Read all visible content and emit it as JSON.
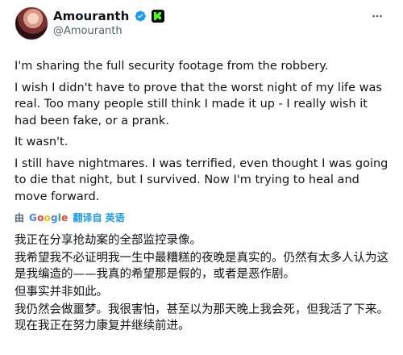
{
  "author": {
    "display_name": "Amouranth",
    "handle": "@Amouranth",
    "verified_color": "#1d9bf0",
    "badge_color": "#53fc18"
  },
  "tweet": {
    "en_lines": [
      "I'm sharing the full security footage from the robbery.",
      "I wish I didn't have to prove that the worst night of my life was real. Too many people still think I made it up - I really wish it had been fake, or a prank.",
      "It wasn't.",
      "I still have nightmares. I was terrified, even thought I was going to die that night, but I survived. Now I'm trying to heal and move forward."
    ],
    "translation": {
      "prefix": "由",
      "provider": "Google",
      "link": "翻译自 英语"
    },
    "zh_lines": [
      "我正在分享抢劫案的全部监控录像。",
      "我希望我不必证明我一生中最糟糕的夜晚是真实的。仍然有太多人认为这是我编造的——我真的希望那是假的，或者是恶作剧。",
      "但事实并非如此。",
      "我仍然会做噩梦。我很害怕，甚至以为那天晚上我会死，但我活了下来。现在我正在努力康复并继续前进。"
    ]
  },
  "icons": {
    "more": "more-icon",
    "verified": "verified-icon",
    "kick": "kick-badge-icon"
  }
}
